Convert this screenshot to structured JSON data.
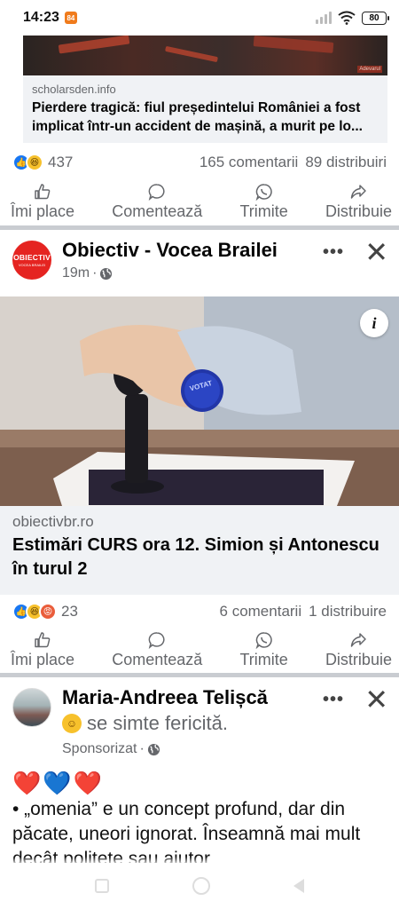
{
  "status_bar": {
    "time": "14:23",
    "battery": "80",
    "app_badge": "84"
  },
  "post1": {
    "image_watermark": "Adevarul",
    "link_domain": "scholarsden.info",
    "link_title": "Pierdere tragică: fiul președintelui României a fost implicat într-un accident de mașină, a murit pe lo...",
    "reaction_count": "437",
    "comments": "165 comentarii",
    "shares": "89 distribuiri"
  },
  "post2": {
    "author": "Obiectiv - Vocea Brailei",
    "time": "19m",
    "avatar_text": "OBIECTIV",
    "avatar_sub": "VOCEA BRAILEI",
    "info_icon_label": "i",
    "stamp_text": "VOTAT",
    "link_domain": "obiectivbr.ro",
    "link_title": "Estimări CURS ora 12. Simion și Antonescu în turul 2",
    "reaction_count": "23",
    "comments": "6 comentarii",
    "shares": "1 distribuire"
  },
  "post3": {
    "author": "Maria-Andreea Telișcă",
    "feeling": "se simte fericită.",
    "sponsored": "Sponsorizat",
    "hearts": [
      "❤️",
      "💙",
      "❤️"
    ],
    "text": "• „omenia” e un concept profund, dar din păcate, uneori ignorat. Înseamnă mai mult decât politețe sau ajutor"
  },
  "actions": {
    "like": "Îmi place",
    "comment": "Comentează",
    "send": "Trimite",
    "share": "Distribuie"
  },
  "more_label": "•••",
  "close_label": "✕",
  "meta_separator": "·",
  "colors": {
    "accent": "#1877f2",
    "separator": "#c9ccd1",
    "link_bg": "#f0f2f5",
    "secondary_text": "#65676b"
  }
}
